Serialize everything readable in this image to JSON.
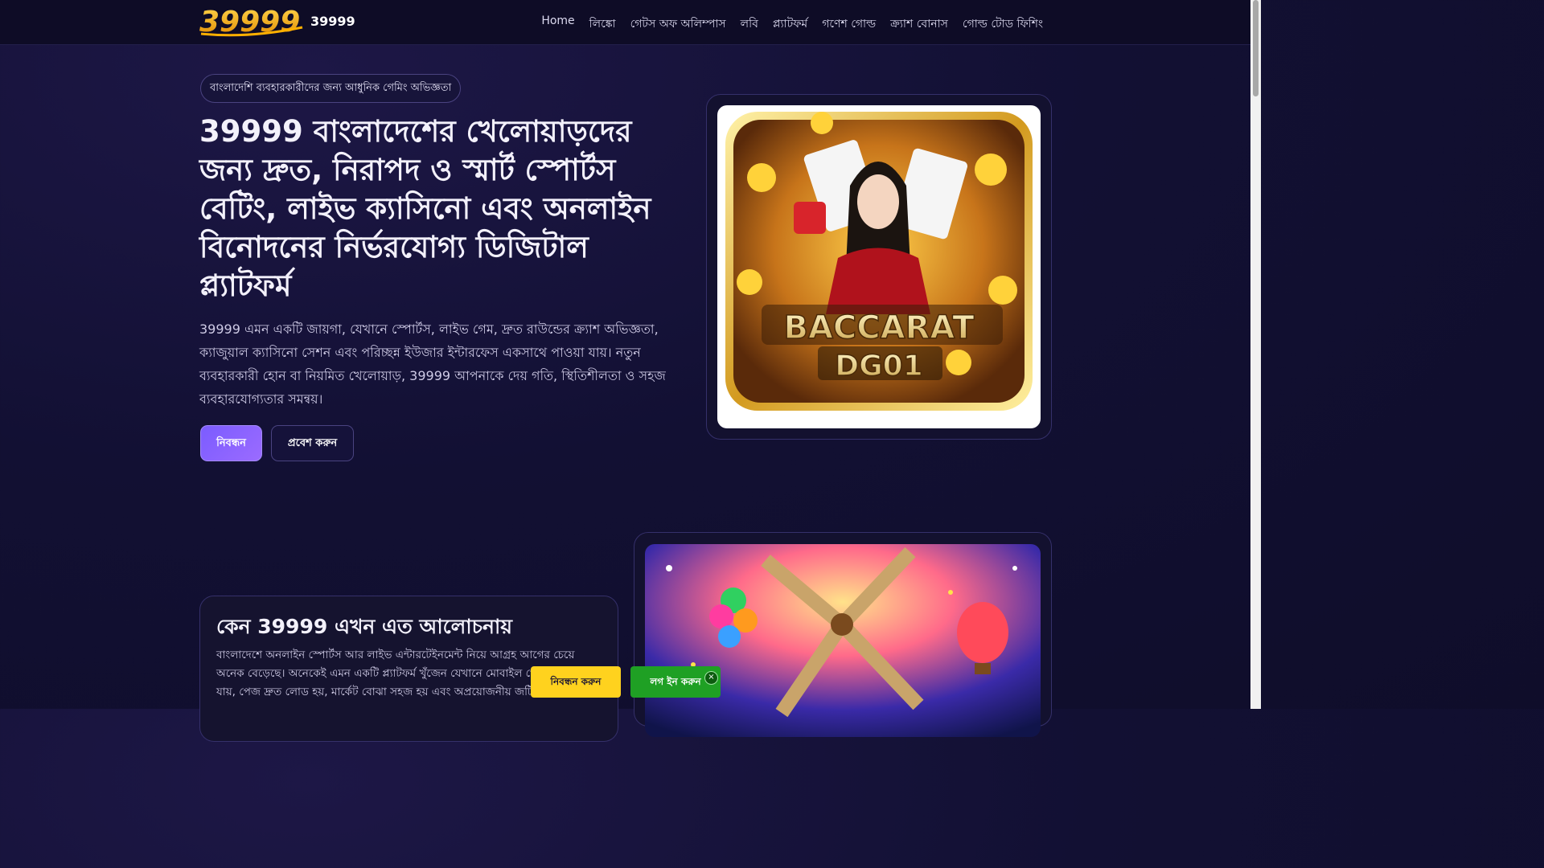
{
  "header": {
    "brand_logo_text": "39999",
    "brand_name": "39999",
    "nav": [
      "Home",
      "লিঙ্কো",
      "গেটস অফ অলিম্পাস",
      "লবি",
      "প্ল্যাটফর্ম",
      "গণেশ গোল্ড",
      "ক্র্যাশ বোনাস",
      "গোল্ড টোড ফিশিং"
    ]
  },
  "hero": {
    "badge": "বাংলাদেশি ব্যবহারকারীদের জন্য আধুনিক গেমিং অভিজ্ঞতা",
    "title": "39999 বাংলাদেশের খেলোয়াড়দের জন্য দ্রুত, নিরাপদ ও স্মার্ট স্পোর্টস বেটিং, লাইভ ক্যাসিনো এবং অনলাইন বিনোদনের নির্ভরযোগ্য ডিজিটাল প্ল্যাটফর্ম",
    "description": "39999 এমন একটি জায়গা, যেখানে স্পোর্টস, লাইভ গেম, দ্রুত রাউন্ডের ক্র্যাশ অভিজ্ঞতা, ক্যাজুয়াল ক্যাসিনো সেশন এবং পরিচ্ছন্ন ইউজার ইন্টারফেস একসাথে পাওয়া যায়। নতুন ব্যবহারকারী হোন বা নিয়মিত খেলোয়াড়, 39999 আপনাকে দেয় গতি, স্থিতিশীলতা ও সহজ ব্যবহারযোগ্যতার সমন্বয়।",
    "register_button": "নিবন্ধন",
    "login_button": "প্রবেশ করুন"
  },
  "game_card": {
    "title_line1": "BACCARAT",
    "title_line2": "DG01"
  },
  "why_section": {
    "title": "কেন 39999 এখন এত আলোচনায়",
    "text": "বাংলাদেশে অনলাইন স্পোর্টস আর লাইভ এন্টারটেইনমেন্ট নিয়ে আগ্রহ আগের চেয়ে অনেক বেড়েছে। অনেকেই এমন একটি প্ল্যাটফর্ম খুঁজেন যেখানে মোবাইল থেকে সহজেই যায়, পেজ দ্রুত লোড হয়, মার্কেট বোঝা সহজ হয় এবং অপ্রয়োজনীয় জটিলতা"
  },
  "floating": {
    "register": "নিবন্ধন করুন",
    "login": "লগ ইন করুন",
    "close": "×"
  },
  "colors": {
    "background": "#121033",
    "accent": "#7b5cff",
    "register_float": "#ffd21e",
    "login_float": "#1fa024"
  }
}
